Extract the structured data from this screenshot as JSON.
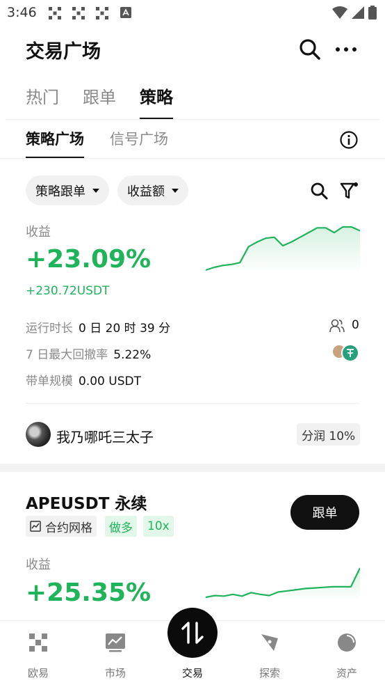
{
  "status_bar": {
    "time": "3:46"
  },
  "header": {
    "title": "交易广场"
  },
  "main_tabs": [
    {
      "label": "热门",
      "active": false
    },
    {
      "label": "跟单",
      "active": false
    },
    {
      "label": "策略",
      "active": true
    }
  ],
  "sub_tabs": [
    {
      "label": "策略广场",
      "active": true
    },
    {
      "label": "信号广场",
      "active": false
    }
  ],
  "filters": {
    "strategy_type": "策略跟单",
    "sort_by": "收益额"
  },
  "card1": {
    "profit_label": "收益",
    "profit_pct": "+23.09%",
    "profit_amount": "+230.72USDT",
    "runtime_label": "运行时长",
    "runtime_value": "0 日 20 时 39 分",
    "followers_count": "0",
    "drawdown_label": "7 日最大回撤率",
    "drawdown_value": "5.22%",
    "aum_label": "带单规模",
    "aum_value": "0.00 USDT",
    "author_name": "我乃哪吒三太子",
    "profit_share": "分润 10%",
    "chart_data": {
      "type": "area",
      "color": "#1fb35a",
      "values": [
        0,
        0.3,
        0.5,
        0.6,
        0.8,
        2.5,
        3,
        3.4,
        3.5,
        2.6,
        3,
        3.5,
        4,
        4.5,
        4.5,
        4,
        4.6,
        4.6,
        4.2
      ]
    }
  },
  "card2": {
    "title": "APEUSDT 永续",
    "tag_contract_grid": "合约网格",
    "tag_long": "做多",
    "tag_leverage": "10x",
    "follow_button": "跟单",
    "profit_label": "收益",
    "profit_pct": "+25.35%",
    "chart_data": {
      "type": "area",
      "color": "#1fb35a",
      "values": [
        0,
        0.3,
        0.2,
        0.5,
        0.2,
        0.8,
        0.5,
        0.3,
        0.9,
        1.1,
        1.3,
        1.5,
        1.6,
        1.7,
        1.8,
        1.8,
        1.8,
        5
      ]
    }
  },
  "bottom_nav": [
    {
      "label": "欧易",
      "icon": "okx-logo-icon"
    },
    {
      "label": "市场",
      "icon": "market-chart-icon"
    },
    {
      "label": "交易",
      "icon": "trade-icon",
      "active": true
    },
    {
      "label": "探索",
      "icon": "explore-icon"
    },
    {
      "label": "资产",
      "icon": "assets-pie-icon"
    }
  ],
  "colors": {
    "accent_green": "#1fb35a",
    "primary": "#111111"
  }
}
